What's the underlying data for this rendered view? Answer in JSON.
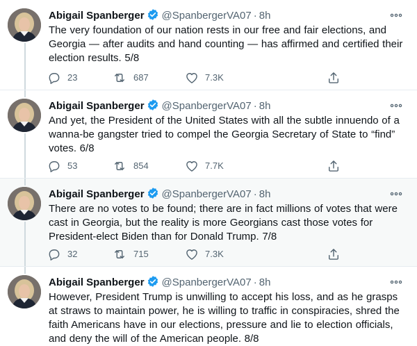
{
  "colors": {
    "text": "#0f1419",
    "muted": "#536471",
    "verified": "#1d9bf0",
    "divider": "#e6ecf0",
    "highlight_bg": "#f7f9f9"
  },
  "icons": {
    "reply": "reply-icon",
    "retweet": "retweet-icon",
    "like": "heart-icon",
    "share": "share-icon",
    "more": "more-icon",
    "verified": "verified-badge-icon"
  },
  "tweets": [
    {
      "author": "Abigail Spanberger",
      "handle": "@SpanbergerVA07",
      "separator": "·",
      "time": "8h",
      "text": "The very foundation of our nation rests in our free and fair elections, and Georgia — after audits and hand counting — has affirmed and certified their election results. 5/8",
      "replies": "23",
      "retweets": "687",
      "likes": "7.3K"
    },
    {
      "author": "Abigail Spanberger",
      "handle": "@SpanbergerVA07",
      "separator": "·",
      "time": "8h",
      "text": "And yet, the President of the United States with all the subtle innuendo of a wanna-be gangster tried to compel the Georgia Secretary of State to “find” votes. 6/8",
      "replies": "53",
      "retweets": "854",
      "likes": "7.7K"
    },
    {
      "author": "Abigail Spanberger",
      "handle": "@SpanbergerVA07",
      "separator": "·",
      "time": "8h",
      "text": "There are no votes to be found; there are in fact millions of votes that were cast in Georgia, but the reality is more Georgians cast those votes for President-elect Biden than for Donald Trump. 7/8",
      "replies": "32",
      "retweets": "715",
      "likes": "7.3K"
    },
    {
      "author": "Abigail Spanberger",
      "handle": "@SpanbergerVA07",
      "separator": "·",
      "time": "8h",
      "text": "However, President Trump is unwilling to accept his loss, and as he grasps at straws to maintain power, he is willing to traffic in conspiracies, shred the faith Americans have in our elections, pressure and lie to election officials, and deny the will of the American people. 8/8"
    }
  ]
}
